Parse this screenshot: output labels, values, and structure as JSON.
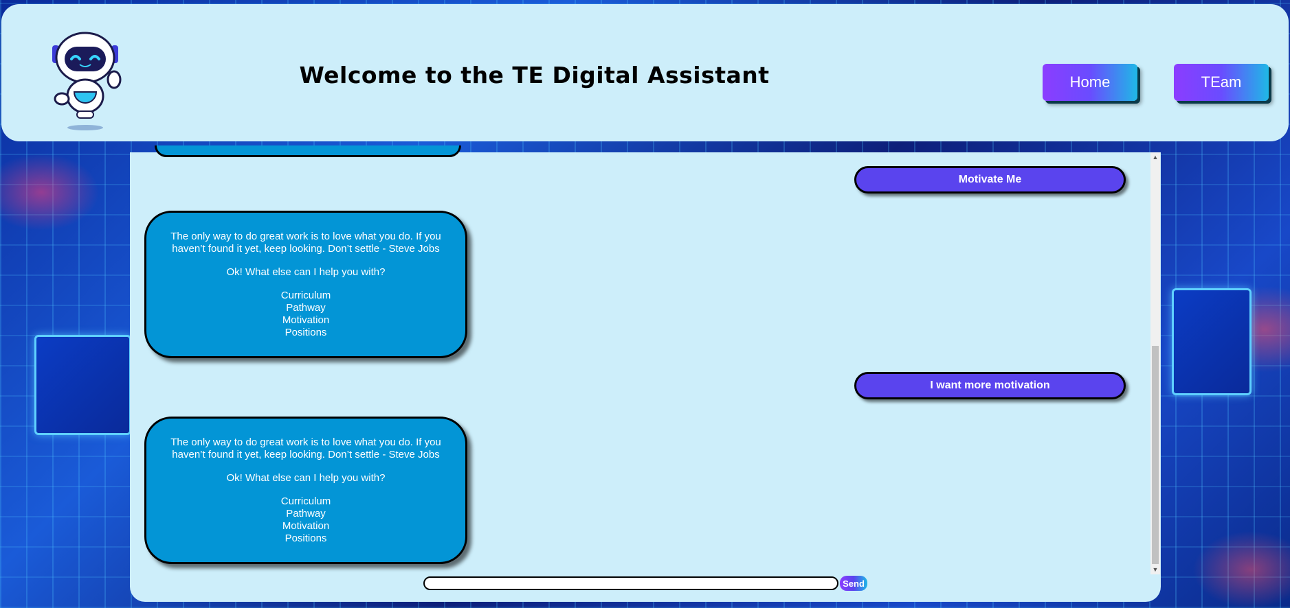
{
  "header": {
    "title": "Welcome to the TE Digital Assistant",
    "nav": [
      {
        "label": "Home"
      },
      {
        "label": "TEam"
      }
    ]
  },
  "chat": {
    "messages": [
      {
        "from": "user",
        "text": "Motivate Me"
      },
      {
        "from": "bot",
        "quote_line1": "The only way to do great work is to love what you do. If you",
        "quote_line2": "haven’t found it yet, keep looking. Don’t settle - Steve Jobs",
        "prompt": "Ok! What else can I help you with?",
        "options": [
          "Curriculum",
          "Pathway",
          "Motivation",
          "Positions"
        ]
      },
      {
        "from": "user",
        "text": "I want more motivation"
      },
      {
        "from": "bot",
        "quote_line1": "The only way to do great work is to love what you do. If you",
        "quote_line2": "haven’t found it yet, keep looking. Don’t settle - Steve Jobs",
        "prompt": "Ok! What else can I help you with?",
        "options": [
          "Curriculum",
          "Pathway",
          "Motivation",
          "Positions"
        ]
      }
    ]
  },
  "composer": {
    "input_value": "",
    "send_label": "Send"
  },
  "colors": {
    "bot_bubble": "#0395d6",
    "user_bubble": "#5a44ee",
    "panel": "#cdeefa"
  }
}
